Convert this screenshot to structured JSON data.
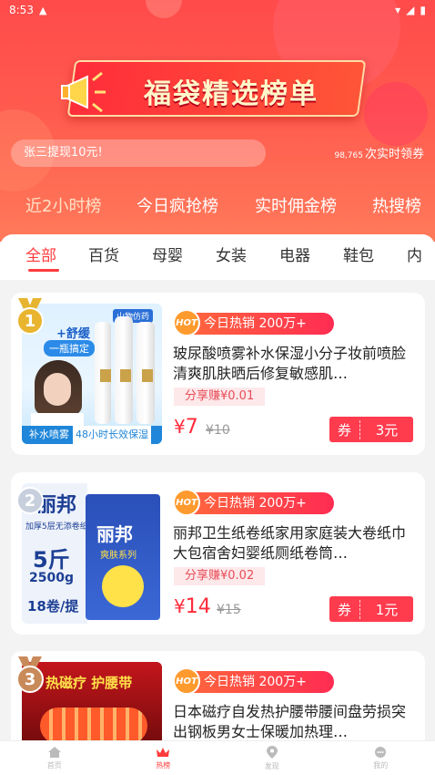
{
  "status": {
    "time": "8:53"
  },
  "hero": {
    "banner_title": "福袋精选榜单",
    "ticker": "张三提现10元!",
    "count_num": "98,765",
    "count_text": "次实时领券"
  },
  "main_tabs": [
    {
      "label": "近2小时榜"
    },
    {
      "label": "今日疯抢榜"
    },
    {
      "label": "实时佣金榜"
    },
    {
      "label": "热搜榜"
    }
  ],
  "categories": [
    {
      "label": "全部"
    },
    {
      "label": "百货"
    },
    {
      "label": "母婴"
    },
    {
      "label": "女装"
    },
    {
      "label": "电器"
    },
    {
      "label": "鞋包"
    },
    {
      "label": "内"
    }
  ],
  "products": [
    {
      "rank": "1",
      "hot_label": "今日热销 200万+",
      "title": "玻尿酸喷雾补水保湿小分子妆前喷脸清爽肌肤晒后修复敏感肌…",
      "share": "分享赚¥0.01",
      "price": "7",
      "orig": "¥10",
      "coupon_label": "券",
      "coupon_value": "3元",
      "thumb_texts": {
        "brand": "山物仿药",
        "tag1": "+舒缓",
        "tag2": "一瓶搞定",
        "foot1": "补水喷雾",
        "foot2": "48小时长效保湿"
      }
    },
    {
      "rank": "2",
      "hot_label": "今日热销 200万+",
      "title": "丽邦卫生纸卷纸家用家庭装大卷纸巾大包宿舍妇婴纸厕纸卷筒…",
      "share": "分享赚¥0.02",
      "price": "14",
      "orig": "¥15",
      "coupon_label": "券",
      "coupon_value": "1元",
      "thumb_texts": {
        "brand": "丽邦",
        "sub": "加厚5层无添卷纸",
        "weight": "5斤",
        "grams": "2500g",
        "rolls": "18卷/提",
        "series": "爽肤系列"
      }
    },
    {
      "rank": "3",
      "hot_label": "今日热销 200万+",
      "title": "日本磁疗自发热护腰带腰间盘劳损突出钢板男女士保暖加热理…",
      "share": "",
      "price": "",
      "orig": "",
      "coupon_label": "",
      "coupon_value": "",
      "thumb_texts": {
        "headline": "热磁疗 护腰带"
      }
    }
  ],
  "bottom_nav": [
    {
      "label": "首页",
      "icon": "home-icon"
    },
    {
      "label": "热榜",
      "icon": "crown-icon"
    },
    {
      "label": "发现",
      "icon": "location-icon"
    },
    {
      "label": "我的",
      "icon": "chat-icon"
    }
  ],
  "colors": {
    "accent": "#ff3b3b",
    "hero_top": "#ff4b4b",
    "coupon": "#ff3b4e"
  }
}
